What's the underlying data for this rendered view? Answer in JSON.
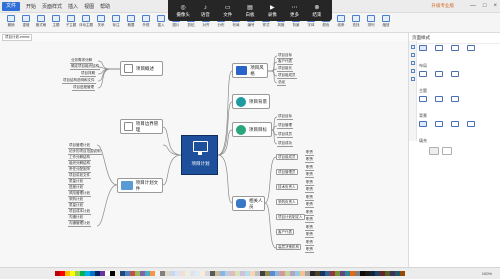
{
  "menu": {
    "file": "文件",
    "items": [
      "开始",
      "页面样式",
      "插入",
      "视图",
      "帮助"
    ]
  },
  "title_right": "升级专业版",
  "window_controls": [
    "—",
    "□",
    "×"
  ],
  "ribbon": {
    "items": [
      "撤销",
      "重做",
      "格式刷",
      "主题",
      "子主题",
      "浮动主题",
      "关系",
      "标注",
      "概要",
      "外框",
      "插入",
      "图片",
      "剪贴",
      "对齐",
      "分布",
      "布局",
      "编号",
      "样式",
      "风格",
      "背景",
      "字体",
      "颜色",
      "线条",
      "查找",
      "排列",
      "缩放"
    ]
  },
  "doc_tab": "项目计划.emmx",
  "floatbar": [
    {
      "glyph": "◎",
      "label": "摄像头"
    },
    {
      "glyph": "♪",
      "label": "语音"
    },
    {
      "glyph": "▭",
      "label": "文件"
    },
    {
      "glyph": "▤",
      "label": "白板"
    },
    {
      "glyph": "▶",
      "label": "录像"
    },
    {
      "glyph": "⋯",
      "label": "更多"
    },
    {
      "glyph": "⊗",
      "label": "结束"
    }
  ],
  "center": "项目计划",
  "topics": {
    "overview": "项目概述",
    "boundary": "项目风格",
    "bg": "项目背景",
    "goal": "项目目标",
    "team": "项目边界管理",
    "docs": "项目计划文件",
    "people": "相关人员"
  },
  "leaves": {
    "overview": [
      "业务需求分解",
      "确定项目组织结构",
      "项目排期",
      "项目结构说明和文件",
      "项目进程管理"
    ],
    "style": [
      "项目目标",
      "客户代表",
      "项目组长",
      "项目组成员",
      "总经"
    ],
    "goal": [
      "项目目标",
      "项目管理",
      "项目成员",
      "项目成功"
    ],
    "docs": [
      "项目管理计划",
      "初步的项目范围说明",
      "工作分解结构",
      "组织分解结构",
      "责任分配矩阵",
      "项目讲划文件",
      "质量计划",
      "进度计划",
      "风险管理计划",
      "采购计划",
      "质量计划",
      "项目成本计划",
      "沟通计划",
      "沟通管理计划"
    ],
    "people": [
      {
        "node": "项目组成员",
        "subs": [
          "职责",
          "职责"
        ]
      },
      {
        "node": "项目管理员",
        "subs": [
          "职责",
          "职责"
        ]
      },
      {
        "node": "技术负责人",
        "subs": [
          "职责",
          "职责"
        ]
      },
      {
        "node": "采购负责人",
        "subs": [
          "职责",
          "职责"
        ]
      },
      {
        "node": "项目计划制定人",
        "subs": [
          "职责",
          "职责"
        ]
      },
      {
        "node": "客户代表",
        "subs": [
          "职责",
          "职责"
        ]
      },
      {
        "node": "高层决策机构",
        "subs": [
          "职责",
          "职责"
        ]
      }
    ]
  },
  "panel": {
    "title": "页面样式",
    "section_layout": "布局",
    "section_theme": "主题",
    "section_bg": "背景",
    "section_fill": "填充"
  },
  "zoom": "100%",
  "colors": [
    "#c00000",
    "#ff0000",
    "#ffc000",
    "#ffff00",
    "#92d050",
    "#00b050",
    "#00b0f0",
    "#0070c0",
    "#002060",
    "#7030a0",
    "#ffffff",
    "#000000",
    "#eeece1",
    "#1f497d",
    "#4f81bd",
    "#c0504d",
    "#9bbb59",
    "#8064a2",
    "#4bacc6",
    "#f79646",
    "#f2f2f2",
    "#7f7f7f",
    "#ddd9c3",
    "#c6d9f0",
    "#dbe5f1",
    "#f2dcdb",
    "#ebf1dd",
    "#e5e0ec",
    "#dbeef3",
    "#fdeada",
    "#d8d8d8",
    "#595959",
    "#c4bd97",
    "#8db3e2",
    "#b8cce4",
    "#e5b9b7",
    "#d7e3bc",
    "#ccc1d9",
    "#b7dde8",
    "#fbd5b5",
    "#bfbfbf",
    "#3f3f3f",
    "#938953",
    "#548dd4",
    "#95b3d7",
    "#d99694",
    "#c3d69b",
    "#b2a2c7",
    "#92cddc",
    "#fac08f",
    "#a5a5a5",
    "#262626",
    "#494429",
    "#17365d",
    "#366092",
    "#953734",
    "#76923c",
    "#5f497a",
    "#31859b",
    "#e36c09",
    "#7f7f7f",
    "#0c0c0c",
    "#1d1b10",
    "#0f243e",
    "#244061",
    "#632423",
    "#4f6128",
    "#3f3151",
    "#205867",
    "#974806"
  ]
}
